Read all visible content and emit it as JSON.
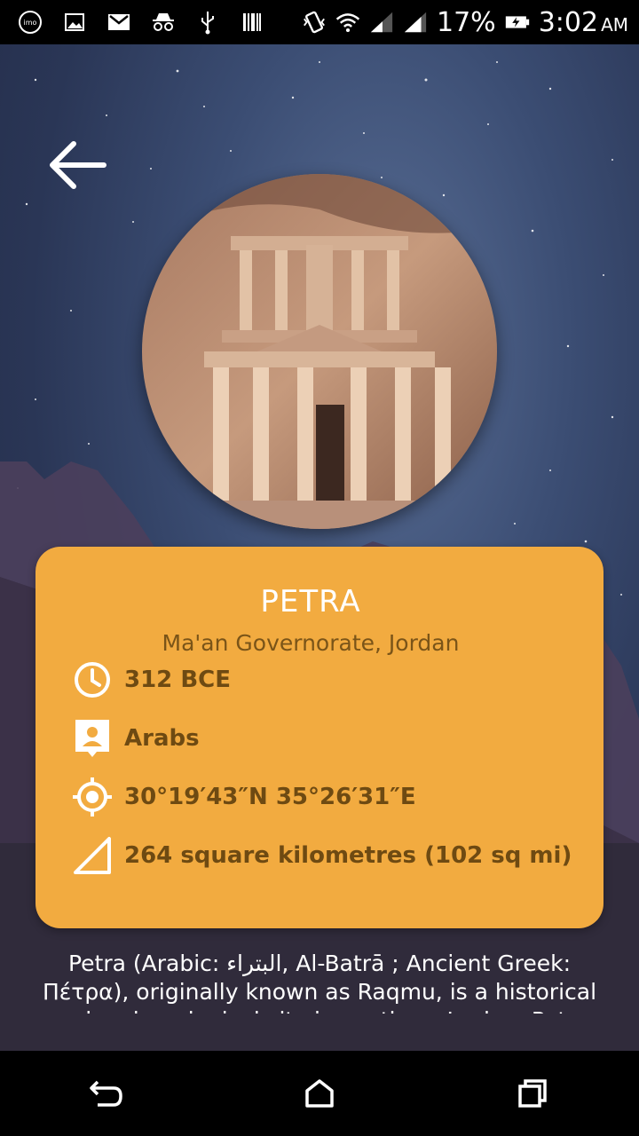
{
  "status_bar": {
    "icons": [
      "imo-icon",
      "image-icon",
      "gmail-icon",
      "incognito-icon",
      "usb-icon",
      "barcode-icon",
      "vibrate-icon",
      "wifi-icon",
      "signal-icon",
      "signal-icon",
      "battery-charging-icon"
    ],
    "imo_label": "imo",
    "battery": "17%",
    "time": "3:02",
    "ampm": "AM"
  },
  "back_icon": "arrow-left-icon",
  "place": {
    "name": "PETRA",
    "location": "Ma'an Governorate, Jordan",
    "founded": "312 BCE",
    "people": "Arabs",
    "coordinates": "30°19′43″N 35°26′31″E",
    "area": "264 square kilometres (102 sq mi)",
    "description": "Petra (Arabic: البتراء, Al-Batrā ; Ancient Greek: Πέτρα), originally known as Raqmu, is a historical and archaeological city in southern Jordan. Petra lies"
  },
  "icons": {
    "founded": "clock-icon",
    "people": "person-badge-icon",
    "coordinates": "gps-target-icon",
    "area": "triangle-area-icon"
  },
  "colors": {
    "card": "#f2ab40",
    "card_text": "#6e4a12",
    "title": "#ffffff"
  },
  "nav": [
    "back-nav-icon",
    "home-nav-icon",
    "recents-nav-icon"
  ]
}
